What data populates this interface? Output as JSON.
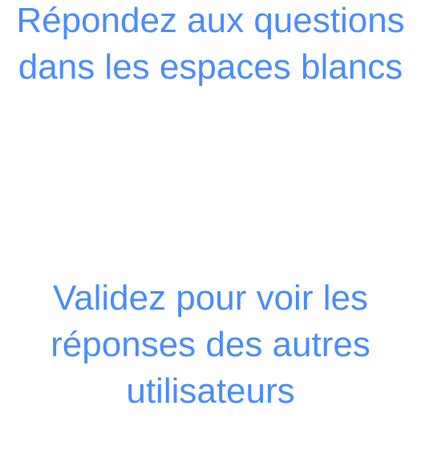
{
  "instructions": {
    "prompt": "Répondez aux questions dans les espaces blancs",
    "submit_hint": "Validez pour voir les réponses des autres utilisateurs"
  },
  "colors": {
    "text": "#4a8cff",
    "background": "#ffffff"
  }
}
